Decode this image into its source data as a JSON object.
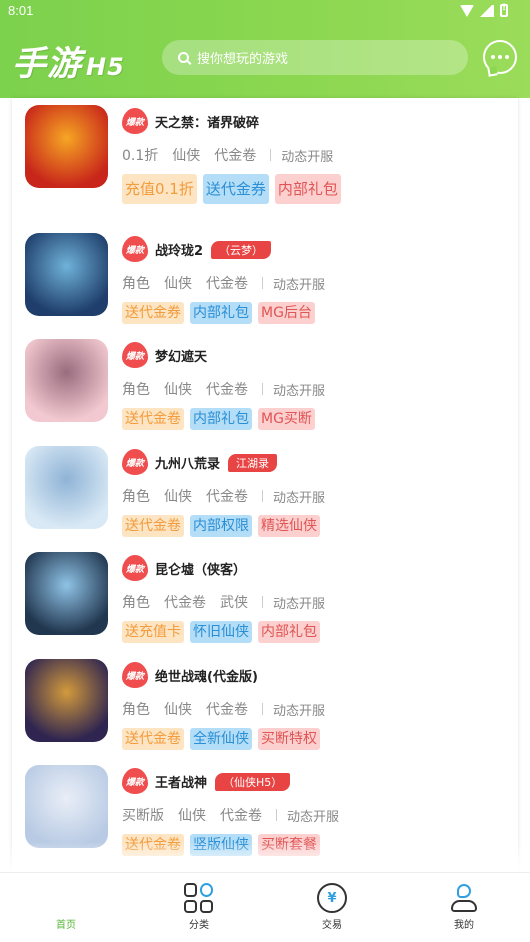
{
  "status": {
    "time": "8:01"
  },
  "header": {
    "logo_main": "手游",
    "logo_suffix": "H5",
    "search_placeholder": "搜你想玩的游戏"
  },
  "badge_text": "爆款",
  "games": [
    {
      "name": "天之禁：诸界破碎",
      "tag": "",
      "meta": [
        "0.1折",
        "仙侠",
        "代金卷"
      ],
      "tail": "动态开服",
      "chips": [
        "充值0.1折",
        "送代金券",
        "内部礼包"
      ],
      "cover_colors": [
        "#c8261a",
        "#f6a624"
      ]
    },
    {
      "name": "战玲珑2",
      "tag": "（云梦）",
      "meta": [
        "角色",
        "仙侠",
        "代金卷"
      ],
      "tail": "动态开服",
      "chips": [
        "送代金券",
        "内部礼包",
        "MG后台"
      ],
      "cover_colors": [
        "#1f3e6b",
        "#6fb2d9"
      ]
    },
    {
      "name": "梦幻遮天",
      "tag": "",
      "meta": [
        "角色",
        "仙侠",
        "代金卷"
      ],
      "tail": "动态开服",
      "chips": [
        "送代金卷",
        "内部礼包",
        "MG买断"
      ],
      "cover_colors": [
        "#f2c9d0",
        "#9a6c7e"
      ]
    },
    {
      "name": "九州八荒录",
      "tag": "江湖录",
      "meta": [
        "角色",
        "仙侠",
        "代金卷"
      ],
      "tail": "动态开服",
      "chips": [
        "送代金卷",
        "内部权限",
        "精选仙侠"
      ],
      "cover_colors": [
        "#d9e9f5",
        "#8fb3d6"
      ]
    },
    {
      "name": "昆仑墟（侠客）",
      "tag": "",
      "meta": [
        "角色",
        "代金卷",
        "武侠"
      ],
      "tail": "动态开服",
      "chips": [
        "送充值卡",
        "怀旧仙侠",
        "内部礼包"
      ],
      "cover_colors": [
        "#21364f",
        "#8fc3e6"
      ]
    },
    {
      "name": "绝世战魂(代金版)",
      "tag": "",
      "meta": [
        "角色",
        "仙侠",
        "代金卷"
      ],
      "tail": "动态开服",
      "chips": [
        "送代金卷",
        "全新仙侠",
        "买断特权"
      ],
      "cover_colors": [
        "#2f2550",
        "#d39a3c"
      ]
    },
    {
      "name": "王者战神",
      "tag": "（仙侠H5）",
      "meta": [
        "买断版",
        "仙侠",
        "代金卷"
      ],
      "tail": "动态开服",
      "chips": [
        "送代金卷",
        "竖版仙侠",
        "买断套餐"
      ],
      "cover_colors": [
        "#b9cbe4",
        "#e9eef7"
      ]
    }
  ],
  "tabs": [
    {
      "label": "首页",
      "icon": "home-icon",
      "active": true
    },
    {
      "label": "分类",
      "icon": "category-icon"
    },
    {
      "label": "交易",
      "icon": "trade-icon"
    },
    {
      "label": "我的",
      "icon": "profile-icon"
    }
  ],
  "colors": {
    "brand_green": "#8bd750",
    "active_tab": "#59b53a",
    "hot_red": "#e94444"
  }
}
